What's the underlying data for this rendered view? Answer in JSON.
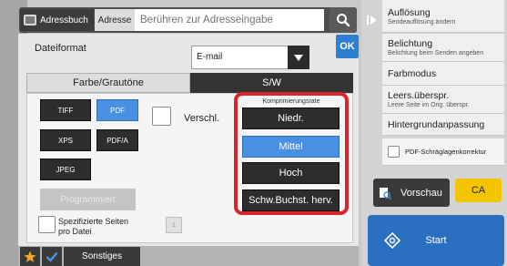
{
  "topbar": {
    "addressbook_label": "Adressbuch",
    "address_tab_label": "Adresse",
    "address_placeholder": "Berühren zur Adresseingabe"
  },
  "format": {
    "label": "Dateiformat",
    "selected": "E-mail"
  },
  "ok_label": "OK",
  "tabs": {
    "color": "Farbe/Grautöne",
    "bw": "S/W"
  },
  "file_types": {
    "tiff": "TIFF",
    "pdf": "PDF",
    "xps": "XPS",
    "pdfa": "PDF/A",
    "jpeg": "JPEG",
    "selected": "PDF"
  },
  "programmed_label": "Programmiert",
  "encrypt_label": "Verschl.",
  "compression": {
    "title": "Komprimierungsrate",
    "options": [
      "Niedr.",
      "Mittel",
      "Hoch",
      "Schw.Buchst. herv."
    ],
    "selected": "Mittel"
  },
  "pages_per_file": {
    "label_line1": "Spezifizierte Seiten",
    "label_line2": "pro Datei",
    "value": "1"
  },
  "bottom": {
    "other_label": "Sonstiges"
  },
  "sidebar": {
    "items": [
      {
        "title": "Auflösung",
        "subtitle": "Sendeauflösung ändern"
      },
      {
        "title": "Belichtung",
        "subtitle": "Belichtung beim Senden angeben"
      },
      {
        "title": "Farbmodus",
        "subtitle": ""
      },
      {
        "title": "Leers.überspr.",
        "subtitle": "Leere Seite im Orig. überspr."
      },
      {
        "title": "Hintergrundanpassung",
        "subtitle": ""
      }
    ],
    "pdf_skew_label": "PDF-Schräglagenkorrektur"
  },
  "actions": {
    "preview": "Vorschau",
    "ca": "CA",
    "start": "Start"
  },
  "colors": {
    "accent_blue": "#4a90e2",
    "highlight_red": "#d8242b",
    "ca_yellow": "#f2c500",
    "start_blue": "#2a6fc0"
  }
}
